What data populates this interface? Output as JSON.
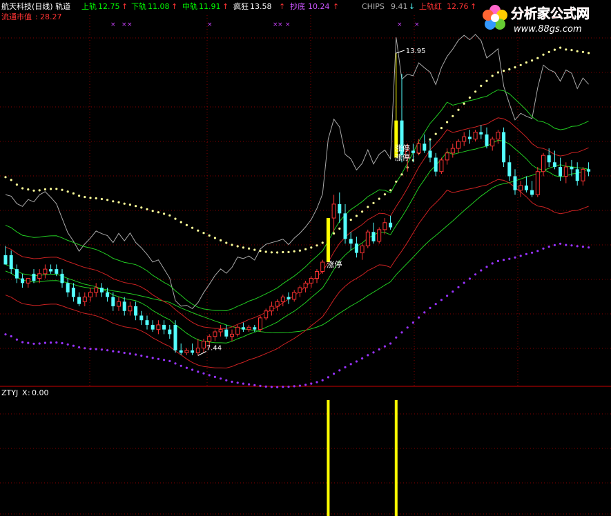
{
  "header": {
    "title": "航天科技(日线) 轨道",
    "indicators": [
      {
        "label": "上轨",
        "value": "12.75",
        "color": "#00ff00"
      },
      {
        "label": "下轨",
        "value": "11.08",
        "color": "#00ff00"
      },
      {
        "label": "中轨",
        "value": "11.91",
        "color": "#00ff00"
      },
      {
        "label": "疯狂",
        "value": "13.58",
        "color": "#ffffff"
      },
      {
        "label": "抄底",
        "value": "10.24",
        "color": "#cc55ff"
      }
    ],
    "chips_label": "CHIPS",
    "chips_value": "9.41",
    "upper_red_label": "上轨红",
    "upper_red_value": "12.76",
    "market_cap_label": "流通市值",
    "market_cap_value": "28.27"
  },
  "watermark": {
    "site_name": "分析家公式网",
    "url": "www.88gs.com"
  },
  "lower_panel": {
    "title": "ZTYJ",
    "x_label": "X",
    "x_value": "0.00"
  },
  "colors": {
    "up_candle": "#ff3333",
    "down_candle": "#54ffff",
    "limit_up_candle": "#ffff00",
    "upper_green": "#22cc22",
    "red_band": "#cc2222",
    "crazy_dots": "#ffff99",
    "bottom_dots": "#9933ff",
    "chips_line": "#aaaaaa",
    "grid": "#880000"
  },
  "chart_data": {
    "type": "candlestick",
    "y_range": [
      7.0,
      14.5
    ],
    "annotations": [
      {
        "text": "13.95",
        "bar": 69,
        "price": 13.95,
        "kind": "high"
      },
      {
        "text": "7.44",
        "bar": 34,
        "price": 7.44,
        "kind": "low"
      },
      {
        "text": "涨停",
        "bar": 57,
        "price": 9.35,
        "kind": "limit_up"
      },
      {
        "text": "涨停",
        "bar": 69,
        "price": 11.85,
        "kind": "limit_up"
      },
      {
        "text": "涨停",
        "bar": 69,
        "price": 11.65,
        "kind": "limit_up"
      }
    ],
    "candles": [
      [
        9.6,
        9.8,
        9.4,
        9.4
      ],
      [
        9.6,
        9.7,
        9.2,
        9.3
      ],
      [
        9.3,
        9.4,
        9.0,
        9.1
      ],
      [
        9.1,
        9.2,
        8.9,
        9.0
      ],
      [
        9.0,
        9.1,
        8.9,
        9.1
      ],
      [
        9.2,
        9.3,
        9.0,
        9.05
      ],
      [
        9.1,
        9.3,
        9.0,
        9.2
      ],
      [
        9.2,
        9.4,
        9.1,
        9.3
      ],
      [
        9.3,
        9.4,
        9.2,
        9.25
      ],
      [
        9.3,
        9.4,
        9.15,
        9.2
      ],
      [
        9.2,
        9.3,
        8.9,
        9.0
      ],
      [
        9.0,
        9.1,
        8.7,
        8.8
      ],
      [
        8.9,
        9.0,
        8.6,
        8.7
      ],
      [
        8.7,
        8.8,
        8.5,
        8.55
      ],
      [
        8.6,
        8.8,
        8.5,
        8.7
      ],
      [
        8.7,
        8.9,
        8.6,
        8.8
      ],
      [
        8.8,
        9.0,
        8.7,
        8.9
      ],
      [
        8.9,
        9.0,
        8.7,
        8.8
      ],
      [
        8.8,
        8.9,
        8.6,
        8.7
      ],
      [
        8.7,
        8.8,
        8.4,
        8.5
      ],
      [
        8.5,
        8.7,
        8.4,
        8.6
      ],
      [
        8.6,
        8.7,
        8.3,
        8.4
      ],
      [
        8.4,
        8.6,
        8.3,
        8.5
      ],
      [
        8.5,
        8.6,
        8.2,
        8.3
      ],
      [
        8.3,
        8.4,
        8.1,
        8.2
      ],
      [
        8.2,
        8.3,
        8.0,
        8.1
      ],
      [
        8.1,
        8.2,
        7.95,
        8.0
      ],
      [
        8.0,
        8.2,
        7.9,
        8.1
      ],
      [
        8.1,
        8.2,
        7.9,
        8.0
      ],
      [
        8.0,
        8.1,
        7.8,
        7.9
      ],
      [
        8.1,
        8.2,
        7.5,
        7.55
      ],
      [
        7.55,
        7.7,
        7.45,
        7.5
      ],
      [
        7.5,
        7.6,
        7.45,
        7.55
      ],
      [
        7.55,
        7.7,
        7.45,
        7.5
      ],
      [
        7.5,
        7.8,
        7.44,
        7.6
      ],
      [
        7.6,
        7.8,
        7.5,
        7.75
      ],
      [
        7.75,
        7.9,
        7.6,
        7.85
      ],
      [
        7.85,
        8.0,
        7.75,
        7.95
      ],
      [
        7.95,
        8.1,
        7.85,
        8.0
      ],
      [
        8.0,
        8.1,
        7.8,
        7.85
      ],
      [
        7.85,
        8.0,
        7.75,
        7.9
      ],
      [
        7.9,
        8.1,
        7.85,
        8.05
      ],
      [
        8.05,
        8.15,
        7.95,
        8.0
      ],
      [
        8.0,
        8.1,
        7.95,
        8.05
      ],
      [
        8.05,
        8.1,
        7.95,
        8.0
      ],
      [
        8.0,
        8.3,
        7.95,
        8.25
      ],
      [
        8.25,
        8.45,
        8.2,
        8.4
      ],
      [
        8.4,
        8.6,
        8.3,
        8.5
      ],
      [
        8.5,
        8.65,
        8.4,
        8.6
      ],
      [
        8.6,
        8.75,
        8.5,
        8.7
      ],
      [
        8.7,
        8.8,
        8.55,
        8.65
      ],
      [
        8.65,
        8.85,
        8.6,
        8.8
      ],
      [
        8.8,
        8.95,
        8.7,
        8.9
      ],
      [
        8.9,
        9.05,
        8.8,
        9.0
      ],
      [
        9.0,
        9.15,
        8.9,
        9.1
      ],
      [
        9.1,
        9.3,
        9.0,
        9.25
      ],
      [
        9.25,
        9.5,
        9.2,
        9.45
      ],
      [
        9.45,
        10.4,
        9.45,
        10.4
      ],
      [
        10.4,
        10.9,
        10.1,
        10.7
      ],
      [
        10.7,
        10.95,
        10.3,
        10.5
      ],
      [
        10.5,
        10.7,
        9.85,
        9.95
      ],
      [
        9.95,
        10.1,
        9.7,
        9.85
      ],
      [
        9.85,
        10.0,
        9.55,
        9.65
      ],
      [
        9.65,
        9.85,
        9.5,
        9.8
      ],
      [
        9.8,
        10.15,
        9.75,
        10.1
      ],
      [
        10.1,
        10.3,
        9.85,
        9.9
      ],
      [
        9.9,
        10.2,
        9.85,
        10.15
      ],
      [
        10.15,
        10.4,
        10.05,
        10.3
      ],
      [
        10.3,
        10.45,
        10.15,
        10.2
      ],
      [
        11.7,
        13.95,
        11.7,
        12.5
      ],
      [
        12.5,
        13.5,
        11.6,
        11.75
      ],
      [
        11.7,
        12.0,
        11.4,
        11.85
      ],
      [
        11.85,
        12.0,
        11.6,
        11.8
      ],
      [
        11.8,
        12.1,
        11.75,
        12.0
      ],
      [
        12.0,
        12.2,
        11.8,
        11.85
      ],
      [
        11.85,
        12.1,
        11.6,
        11.7
      ],
      [
        11.7,
        11.8,
        11.3,
        11.4
      ],
      [
        11.4,
        11.7,
        11.35,
        11.65
      ],
      [
        11.65,
        11.9,
        11.55,
        11.8
      ],
      [
        11.8,
        12.0,
        11.7,
        11.9
      ],
      [
        11.9,
        12.1,
        11.8,
        12.05
      ],
      [
        12.05,
        12.25,
        11.95,
        12.15
      ],
      [
        12.15,
        12.3,
        12.0,
        12.1
      ],
      [
        12.1,
        12.3,
        12.05,
        12.25
      ],
      [
        12.25,
        12.4,
        12.1,
        12.2
      ],
      [
        12.2,
        12.35,
        11.9,
        11.95
      ],
      [
        11.95,
        12.15,
        11.85,
        12.1
      ],
      [
        12.1,
        12.3,
        12.0,
        12.25
      ],
      [
        12.25,
        12.35,
        11.5,
        11.6
      ],
      [
        11.6,
        11.75,
        11.2,
        11.3
      ],
      [
        11.3,
        11.45,
        10.9,
        11.0
      ],
      [
        11.0,
        11.2,
        10.85,
        11.1
      ],
      [
        11.1,
        11.3,
        10.95,
        11.0
      ],
      [
        11.0,
        11.2,
        10.85,
        10.9
      ],
      [
        10.9,
        11.5,
        10.85,
        11.4
      ],
      [
        11.4,
        11.8,
        11.3,
        11.75
      ],
      [
        11.75,
        11.9,
        11.5,
        11.6
      ],
      [
        11.6,
        11.85,
        11.45,
        11.5
      ],
      [
        11.5,
        11.7,
        11.2,
        11.3
      ],
      [
        11.3,
        11.6,
        11.15,
        11.5
      ],
      [
        11.5,
        11.65,
        11.3,
        11.45
      ],
      [
        11.45,
        11.6,
        11.1,
        11.2
      ],
      [
        11.2,
        11.5,
        11.1,
        11.45
      ],
      [
        11.45,
        11.6,
        11.3,
        11.4
      ]
    ]
  }
}
